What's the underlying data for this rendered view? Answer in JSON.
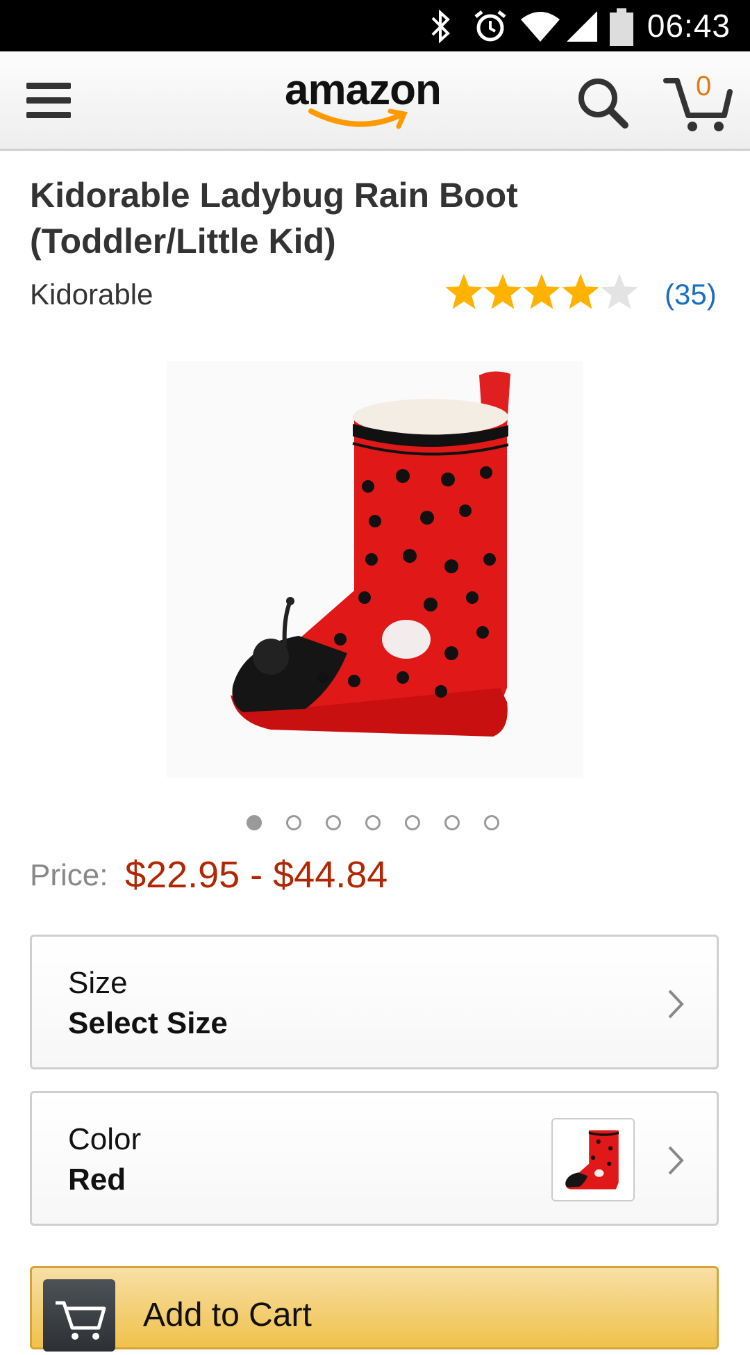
{
  "status_bar": {
    "time": "06:43"
  },
  "header": {
    "logo_text": "amazon",
    "cart_count": "0"
  },
  "product": {
    "title_line1": "Kidorable Ladybug Rain Boot",
    "title_line2": "(Toddler/Little Kid)",
    "brand": "Kidorable",
    "rating": 4,
    "rating_max": 5,
    "reviews": "(35)",
    "image_count": 7,
    "image_active_index": 0,
    "price_label": "Price:",
    "price_range": "$22.95 - $44.84"
  },
  "variations": {
    "size": {
      "label": "Size",
      "value": "Select Size"
    },
    "color": {
      "label": "Color",
      "value": "Red"
    }
  },
  "actions": {
    "add_to_cart": "Add to Cart"
  },
  "colors": {
    "price": "#b12704",
    "link": "#1a6ec3",
    "cart_button": "#f0c14b",
    "star": "#ffb300",
    "amazon_orange": "#f90"
  },
  "icons": {
    "menu": "hamburger-menu-icon",
    "search": "search-icon",
    "cart": "cart-icon",
    "chevron": "chevron-right-icon"
  }
}
